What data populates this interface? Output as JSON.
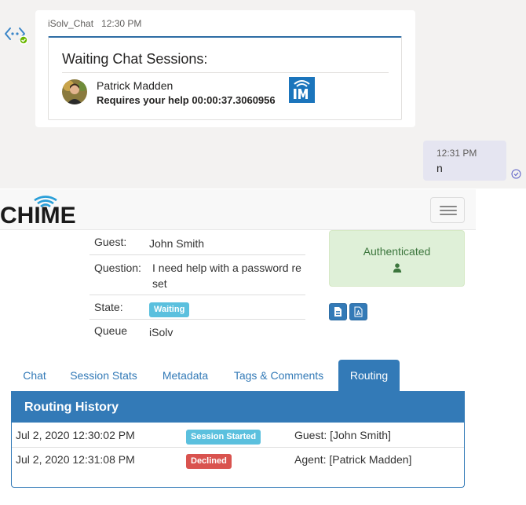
{
  "chat": {
    "bot_message": {
      "sender": "iSolv_Chat",
      "time": "12:30 PM",
      "card_title": "Waiting Chat Sessions:",
      "agent_name": "Patrick Madden",
      "help_text": "Requires your help 00:00:37.3060956"
    },
    "user_message": {
      "time": "12:31 PM",
      "text": "n"
    }
  },
  "app": {
    "logo_text": "CHIME",
    "colors": {
      "primary": "#337ab7",
      "success_bg": "#dff0d8",
      "success_text": "#3c763d",
      "info": "#5bc0de",
      "danger": "#d9534f"
    }
  },
  "session": {
    "guest_label": "Guest:",
    "guest_value": "John Smith",
    "question_label": "Question:",
    "question_value": "I need help with a password reset",
    "state_label": "State:",
    "state_value": "Waiting",
    "queue_label": "Queue",
    "queue_value": "iSolv",
    "auth_status": "Authenticated"
  },
  "tabs": [
    {
      "label": "Chat"
    },
    {
      "label": "Session Stats"
    },
    {
      "label": "Metadata"
    },
    {
      "label": "Tags & Comments"
    },
    {
      "label": "Routing",
      "active": true
    }
  ],
  "routing": {
    "title": "Routing History",
    "rows": [
      {
        "datetime": "Jul 2, 2020 12:30:02 PM",
        "event": "Session Started",
        "event_style": "info",
        "detail": "Guest: [John Smith]"
      },
      {
        "datetime": "Jul 2, 2020 12:31:08 PM",
        "event": "Declined",
        "event_style": "danger",
        "detail": "Agent: [Patrick Madden]"
      }
    ]
  }
}
